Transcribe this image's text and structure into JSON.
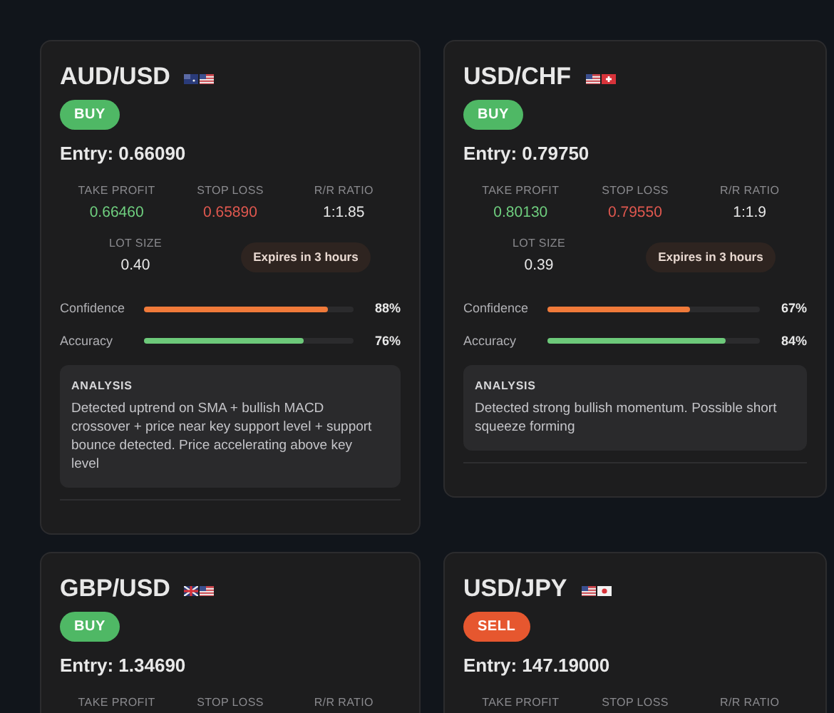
{
  "cards": [
    {
      "pair": "AUD/USD",
      "flags": [
        {
          "kind": "au"
        },
        {
          "kind": "us"
        }
      ],
      "signal": {
        "kind": "buy",
        "label": "BUY"
      },
      "entry": "Entry: 0.66090",
      "metrics": [
        {
          "label": "TAKE PROFIT",
          "value": "0.66460",
          "kind": "profit"
        },
        {
          "label": "STOP LOSS",
          "value": "0.65890",
          "kind": "loss"
        },
        {
          "label": "R/R RATIO",
          "value": "1:1.85",
          "kind": "neutral"
        }
      ],
      "lot": {
        "label": "LOT SIZE",
        "value": "0.40"
      },
      "expires": "Expires in 3 hours",
      "bars": [
        {
          "label": "Confidence",
          "level": 0.88,
          "reading": "88%",
          "kind": "confidence"
        },
        {
          "label": "Accuracy",
          "level": 0.76,
          "reading": "76%",
          "kind": "accuracy"
        }
      ],
      "analysis": {
        "title": "ANALYSIS",
        "text": "Detected uptrend on SMA + bullish MACD crossover + price near key support level + support bounce detected. Price accelerating above key level"
      }
    },
    {
      "pair": "USD/CHF",
      "flags": [
        {
          "kind": "us"
        },
        {
          "kind": "ch"
        }
      ],
      "signal": {
        "kind": "buy",
        "label": "BUY"
      },
      "entry": "Entry: 0.79750",
      "metrics": [
        {
          "label": "TAKE PROFIT",
          "value": "0.80130",
          "kind": "profit"
        },
        {
          "label": "STOP LOSS",
          "value": "0.79550",
          "kind": "loss"
        },
        {
          "label": "R/R RATIO",
          "value": "1:1.9",
          "kind": "neutral"
        }
      ],
      "lot": {
        "label": "LOT SIZE",
        "value": "0.39"
      },
      "expires": "Expires in 3 hours",
      "bars": [
        {
          "label": "Confidence",
          "level": 0.67,
          "reading": "67%",
          "kind": "confidence"
        },
        {
          "label": "Accuracy",
          "level": 0.84,
          "reading": "84%",
          "kind": "accuracy"
        }
      ],
      "analysis": {
        "title": "ANALYSIS",
        "text": "Detected strong bullish momentum. Possible short squeeze forming"
      }
    },
    {
      "pair": "GBP/USD",
      "flags": [
        {
          "kind": "gb"
        },
        {
          "kind": "us"
        }
      ],
      "signal": {
        "kind": "buy",
        "label": "BUY"
      },
      "entry": "Entry: 1.34690",
      "metrics": [
        {
          "label": "TAKE PROFIT"
        },
        {
          "label": "STOP LOSS"
        },
        {
          "label": "R/R RATIO"
        }
      ]
    },
    {
      "pair": "USD/JPY",
      "flags": [
        {
          "kind": "us"
        },
        {
          "kind": "jp"
        }
      ],
      "signal": {
        "kind": "sell",
        "label": "SELL"
      },
      "entry": "Entry: 147.19000",
      "metrics": [
        {
          "label": "TAKE PROFIT"
        },
        {
          "label": "STOP LOSS"
        },
        {
          "label": "R/R RATIO"
        }
      ]
    }
  ]
}
